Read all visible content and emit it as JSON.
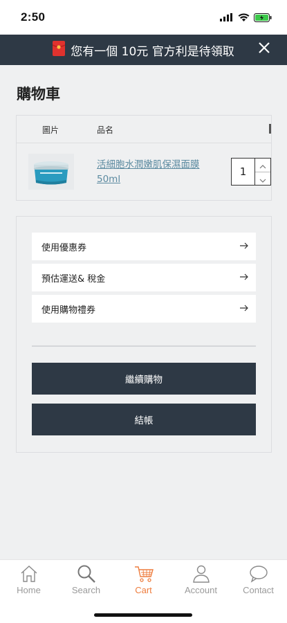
{
  "status_bar": {
    "time": "2:50"
  },
  "promo": {
    "text": "您有一個 10元 官方利是待領取"
  },
  "page": {
    "title": "購物車"
  },
  "cart_table": {
    "headers": {
      "image": "圖片",
      "name": "品名"
    },
    "items": [
      {
        "name": "活細胞水潤嫩肌保濕面膜50ml",
        "quantity": "1"
      }
    ]
  },
  "summary": {
    "options": [
      {
        "label": "使用優惠券"
      },
      {
        "label": "預估運送& 稅金"
      },
      {
        "label": "使用購物禮券"
      }
    ],
    "continue_label": "繼續購物",
    "checkout_label": "結帳"
  },
  "tab_bar": {
    "tabs": [
      {
        "label": "Home",
        "icon": "home-icon"
      },
      {
        "label": "Search",
        "icon": "search-icon"
      },
      {
        "label": "Cart",
        "icon": "cart-icon",
        "active": true
      },
      {
        "label": "Account",
        "icon": "account-icon"
      },
      {
        "label": "Contact",
        "icon": "chat-icon"
      }
    ]
  },
  "colors": {
    "header_dark": "#2e3945",
    "page_bg": "#eff0f1",
    "accent": "#ee7d3e",
    "link": "#5b8aa0"
  }
}
